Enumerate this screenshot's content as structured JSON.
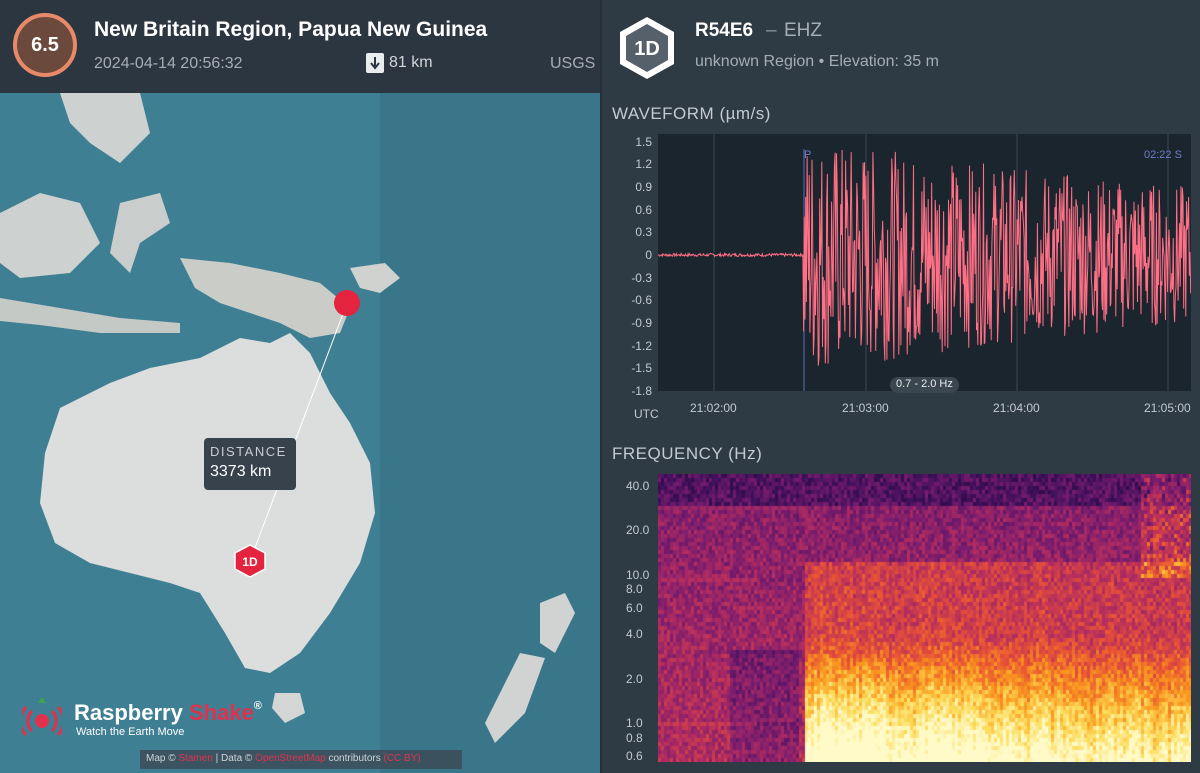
{
  "event": {
    "magnitude": "6.5",
    "title": "New Britain Region, Papua New Guinea",
    "datetime": "2024-04-14 20:56:32",
    "depth": "81 km",
    "source": "USGS"
  },
  "map": {
    "distance_label": "DISTANCE",
    "distance_value": "3373 km",
    "station_marker": "1D",
    "brand_name_1": "Raspberry",
    "brand_name_2": "Shake",
    "brand_reg": "®",
    "brand_tagline": "Watch the Earth Move",
    "attribution": {
      "prefix": "Map ©",
      "link1": "Stamen",
      "middle": "| Data ©",
      "link2": "OpenStreetMap",
      "suffix": "contributors",
      "link3": "(CC BY)"
    },
    "colors": {
      "ocean": "#3f7f93",
      "land": "#d8dadb",
      "quake": "#e4233f",
      "station": "#e4233f"
    }
  },
  "station": {
    "badge": "1D",
    "code": "R54E6",
    "separator": "–",
    "channel": "EHZ",
    "meta": "unknown Region • Elevation: 35 m"
  },
  "waveform": {
    "title": "WAVEFORM  (µm/s)",
    "y_ticks": [
      "1.5",
      "1.2",
      "0.9",
      "0.6",
      "0.3",
      "0",
      "-0.3",
      "-0.6",
      "-0.9",
      "-1.2",
      "-1.5",
      "-1.8"
    ],
    "x_ticks": [
      "21:02:00",
      "21:03:00",
      "21:04:00",
      "21:05:00"
    ],
    "utc_label": "UTC",
    "filter": "0.7 - 2.0 Hz",
    "p_phase": "P",
    "s_phase": "02:22  S",
    "color": "#ff6f85"
  },
  "frequency": {
    "title": "FREQUENCY  (Hz)",
    "ticks": [
      "40.0",
      "20.0",
      "10.0",
      "8.0",
      "6.0",
      "4.0",
      "2.0",
      "1.0",
      "0.8",
      "0.6"
    ]
  },
  "chart_data": [
    {
      "type": "line",
      "title": "WAVEFORM  (µm/s)",
      "xlabel": "UTC",
      "ylabel": "µm/s",
      "ylim": [
        -1.8,
        1.6
      ],
      "x_ticks": [
        "21:02:00",
        "21:03:00",
        "21:04:00",
        "21:05:00"
      ],
      "series": [
        {
          "values_summary": "low noise (±0.02) before P arrival ~21:02:35, then oscillations up to ±1.6 decaying to about ±0.7 by 21:05"
        }
      ]
    },
    {
      "type": "heatmap",
      "title": "FREQUENCY  (Hz)",
      "ylabel": "Hz",
      "y_ticks": [
        "40.0",
        "20.0",
        "10.0",
        "8.0",
        "6.0",
        "4.0",
        "2.0",
        "1.0",
        "0.8",
        "0.6"
      ],
      "grid": false
    }
  ]
}
